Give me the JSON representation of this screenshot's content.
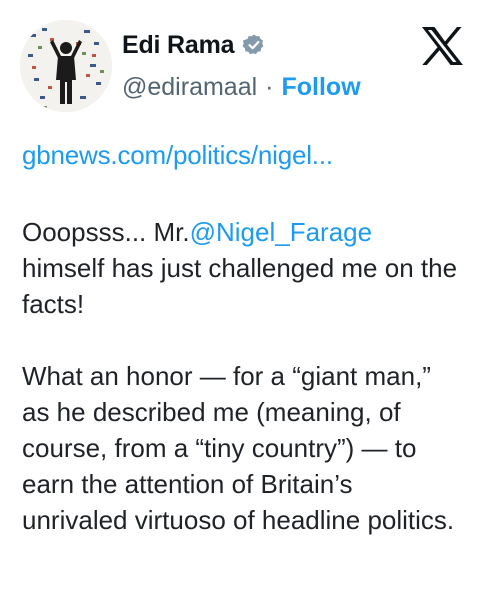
{
  "author": {
    "name": "Edi Rama",
    "handle": "@ediramaal",
    "separator": "·",
    "follow_label": "Follow",
    "verified": true
  },
  "icons": {
    "verified": "verified-badge-icon",
    "platform": "x-logo-icon"
  },
  "tweet": {
    "link": "gbnews.com/politics/nigel...",
    "para1_lead": "Ooopsss... Mr.",
    "para1_mention": "@Nigel_Farage",
    "para1_rest": "himself has just challenged me on the facts!",
    "para2": "What an honor — for a “giant man,” as he described me (meaning, of course, from a “tiny country”) — to earn the attention of Britain’s unrivaled virtuoso of headline politics."
  },
  "colors": {
    "accent": "#1d9bf0",
    "text": "#0f1419",
    "muted": "#536471",
    "verified_badge": "#829aab"
  }
}
